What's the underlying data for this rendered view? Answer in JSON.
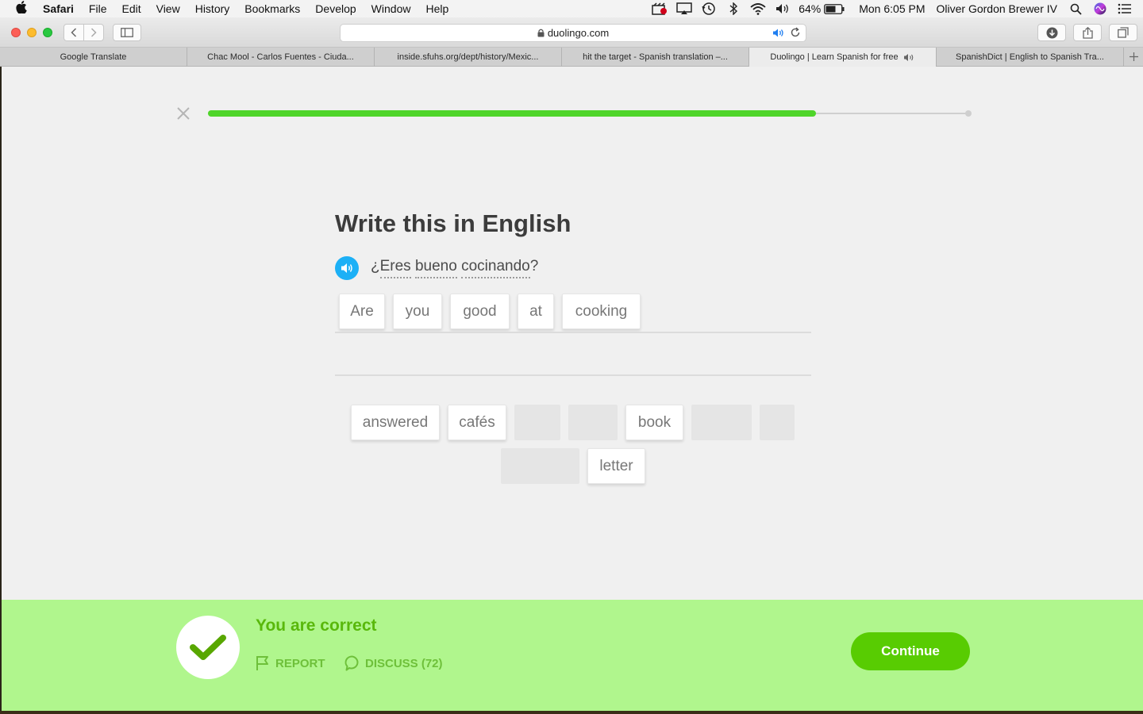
{
  "menubar": {
    "app": "Safari",
    "items": [
      "File",
      "Edit",
      "View",
      "History",
      "Bookmarks",
      "Develop",
      "Window",
      "Help"
    ],
    "battery": "64%",
    "clock": "Mon 6:05 PM",
    "user": "Oliver Gordon Brewer IV"
  },
  "toolbar": {
    "url": "duolingo.com"
  },
  "tabs": [
    {
      "title": "Google Translate"
    },
    {
      "title": "Chac Mool - Carlos Fuentes - Ciuda..."
    },
    {
      "title": "inside.sfuhs.org/dept/history/Mexic..."
    },
    {
      "title": "hit the target - Spanish translation –..."
    },
    {
      "title": "Duolingo | Learn Spanish for free"
    },
    {
      "title": "SpanishDict | English to Spanish Tra..."
    }
  ],
  "lesson": {
    "progress": 0.8,
    "title": "Write this in English",
    "sentence_words": [
      "¿",
      "Eres",
      " ",
      "bueno",
      " ",
      "cocinando",
      "?"
    ],
    "answer_tiles": [
      "Are",
      "you",
      "good",
      "at",
      "cooking"
    ],
    "bank_tiles": [
      "answered",
      "cafés",
      "book",
      "letter"
    ]
  },
  "feedback": {
    "title": "You are correct",
    "report_label": "REPORT",
    "discuss_label": "DISCUSS (72)",
    "continue_label": "Continue"
  },
  "colors": {
    "brand_green": "#58cc02",
    "feedback_bg": "#b0f68d",
    "progress": "#4fd52a",
    "speaker_blue": "#1cb0f6"
  },
  "icons": [
    "apple-icon",
    "search-icon",
    "siri-icon",
    "notification-center-icon",
    "wifi-icon",
    "bluetooth-icon",
    "volume-icon",
    "battery-icon",
    "time-machine-icon",
    "airplay-icon",
    "close-icon",
    "speaker-icon",
    "check-icon",
    "flag-icon",
    "speech-bubble-icon"
  ]
}
